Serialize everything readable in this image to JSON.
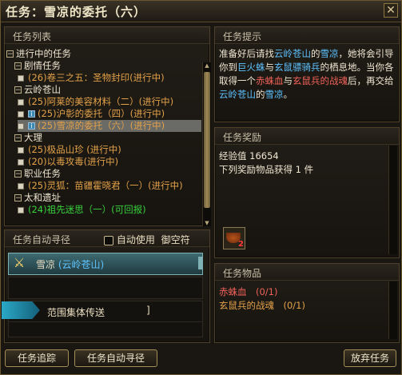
{
  "window": {
    "title": "任务：雪凉的委托（六）",
    "close_glyph": "✕"
  },
  "quest_list": {
    "header": "任务列表",
    "items": [
      {
        "kind": "group",
        "toggle": "−",
        "label": "进行中的任务",
        "color": "normal"
      },
      {
        "kind": "group",
        "toggle": "−",
        "label": "剧情任务",
        "color": "normal"
      },
      {
        "kind": "quest",
        "label": "(26)卷三之五：圣物封印(进行中)",
        "color": "orange"
      },
      {
        "kind": "group",
        "toggle": "−",
        "label": "云岭苍山",
        "color": "normal"
      },
      {
        "kind": "quest",
        "label": "(25)阿莱的美容材料（二）(进行中)",
        "color": "orange"
      },
      {
        "kind": "quest",
        "info": "i",
        "label": "(25)沪彰的委托（四）(进行中)",
        "color": "orange"
      },
      {
        "kind": "quest",
        "info": "i",
        "label": "(25)雪凉的委托（六）(进行中)",
        "color": "orange",
        "selected": true
      },
      {
        "kind": "group",
        "toggle": "−",
        "label": "大理",
        "color": "normal"
      },
      {
        "kind": "quest",
        "label": "(25)极品山珍 (进行中)",
        "color": "orange"
      },
      {
        "kind": "quest",
        "label": "(20)以毒攻毒(进行中)",
        "color": "orange"
      },
      {
        "kind": "group",
        "toggle": "−",
        "label": "职业任务",
        "color": "normal"
      },
      {
        "kind": "quest",
        "label": "(25)灵狐：苗疆霍晓君（一）(进行中)",
        "color": "orange"
      },
      {
        "kind": "group",
        "toggle": "−",
        "label": "太和遗址",
        "color": "normal"
      },
      {
        "kind": "quest",
        "label": "(24)祖先迷思（一）(可回报)",
        "color": "green"
      }
    ]
  },
  "auto_path": {
    "header": "任务自动寻径",
    "checkbox_label": "自动使用",
    "mount_label": "御空符",
    "selected_npc": "雪凉",
    "selected_place": "(云岭苍山)",
    "range_teleport_label": "范围集体传送",
    "track_button": "任务追踪",
    "auto_path_button": "任务自动寻径"
  },
  "hint": {
    "header": "任务提示",
    "segments": [
      {
        "t": "准备好后请找",
        "c": "normal"
      },
      {
        "t": "云岭苍山",
        "c": "blue"
      },
      {
        "t": "的",
        "c": "normal"
      },
      {
        "t": "雪凉",
        "c": "blue"
      },
      {
        "t": "，她将会引导你到",
        "c": "normal"
      },
      {
        "t": "巨火蛛",
        "c": "blue"
      },
      {
        "t": "与",
        "c": "normal"
      },
      {
        "t": "玄鼠骠骑兵",
        "c": "blue"
      },
      {
        "t": "的栖息地。当你各取得一个",
        "c": "normal"
      },
      {
        "t": "赤蛛血",
        "c": "red"
      },
      {
        "t": "与",
        "c": "normal"
      },
      {
        "t": "玄鼠兵的战魂",
        "c": "red"
      },
      {
        "t": "后，再交给",
        "c": "normal"
      },
      {
        "t": "云岭苍山",
        "c": "blue"
      },
      {
        "t": "的",
        "c": "normal"
      },
      {
        "t": "雪凉",
        "c": "blue"
      },
      {
        "t": "。",
        "c": "normal"
      }
    ]
  },
  "reward": {
    "header": "任务奖励",
    "exp_line": "经验值 16654",
    "items_line": "下列奖励物品获得 1 件",
    "item_icon": "tea-cup-icon",
    "item_count": "2"
  },
  "quest_items": {
    "header": "任务物品",
    "items": [
      {
        "label": "赤蛛血　(0/1)",
        "color": "red"
      },
      {
        "label": "玄鼠兵的战魂　(0/1)",
        "color": "orange"
      }
    ]
  },
  "abandon_button": "放弃任务"
}
